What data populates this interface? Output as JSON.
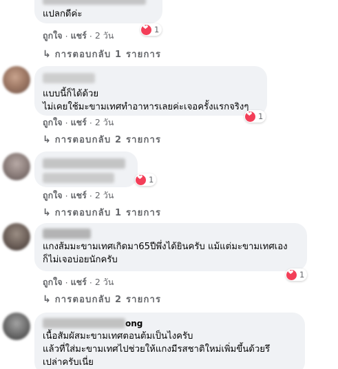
{
  "colors": {
    "bubble": "#f0f2f5",
    "muted": "#65676b",
    "text": "#050505",
    "heart": "#f33e58",
    "like": "#1877f2"
  },
  "comments": [
    {
      "author": "",
      "text": "แปลกดีค่ะ",
      "reactions": "1",
      "like": "ถูกใจ",
      "share": "แชร์",
      "time": "2 วัน",
      "replies": "การตอบกลับ 1 รายการ"
    },
    {
      "author": "",
      "text": "แบบนี้ก็ได้ด้วย\nไม่เคยใช้มะขามเทศทำอาหารเลยค่ะเจอครั้งแรกจริงๆ",
      "reactions": "1",
      "like": "ถูกใจ",
      "share": "แชร์",
      "time": "2 วัน",
      "replies": "การตอบกลับ 2 รายการ"
    },
    {
      "author": "",
      "text": "",
      "reactions": "1",
      "like": "ถูกใจ",
      "share": "แชร์",
      "time": "2 วัน",
      "replies": "การตอบกลับ 1 รายการ"
    },
    {
      "author": "",
      "text": "แกงส้มมะขามเทศเกิดมา65ปีพึ่งได้ยินครับ แม้แต่มะขามเทศเอง\nก็ไม่เจอบ่อยนักครับ",
      "reactions": "1",
      "like": "ถูกใจ",
      "share": "แชร์",
      "time": "2 วัน",
      "replies": "การตอบกลับ 2 รายการ"
    },
    {
      "author": "ong",
      "text": "เนื้อสัมผัสมะขามเทศตอนต้มเป็นไงครับ\nแล้วที่ใส่มะขามเทศไปช่วยให้แกงมีรสชาติใหม่เพิ่มขึ้นด้วยรึ\nเปล่าครับเนี่ย"
    }
  ],
  "separator": "·",
  "reply_arrow": "↳"
}
